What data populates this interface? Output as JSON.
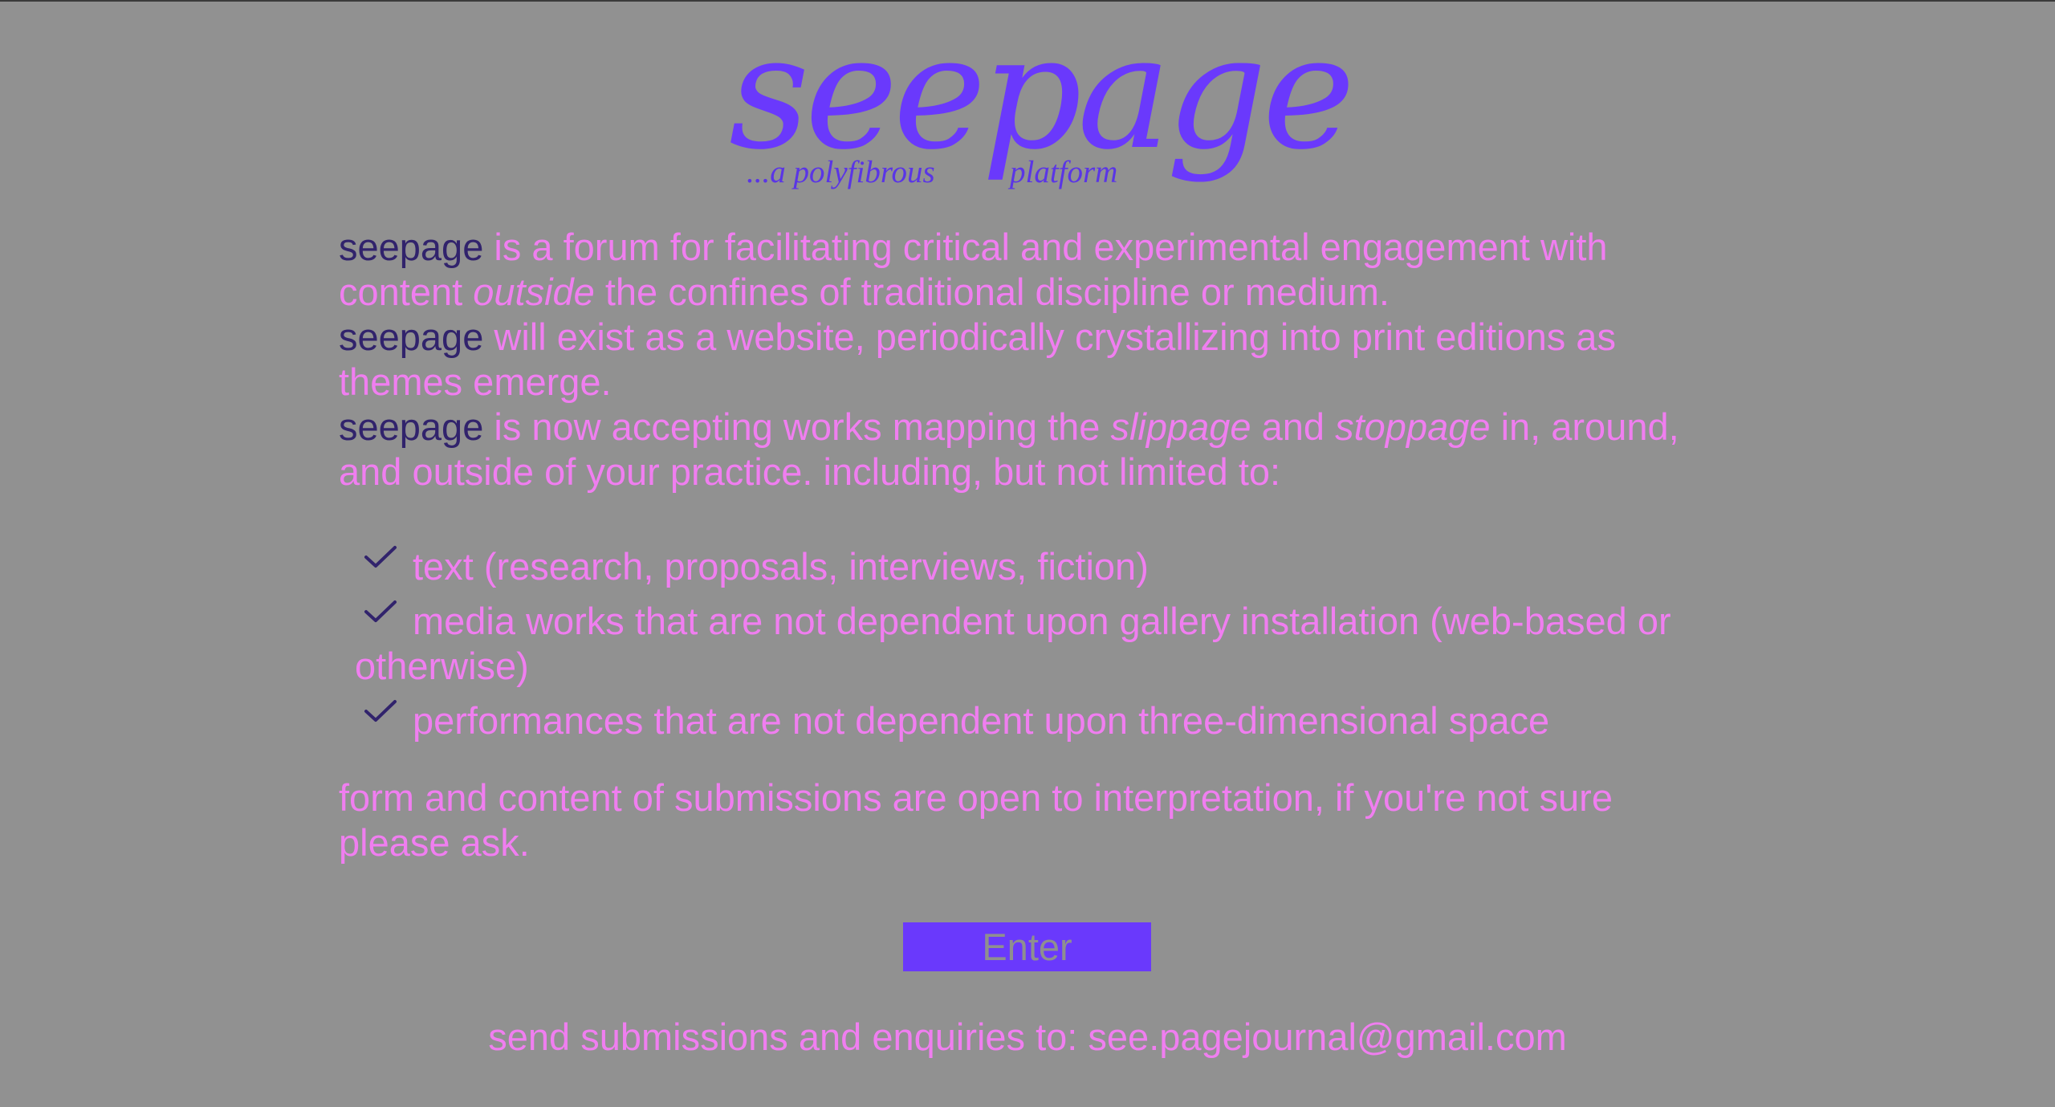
{
  "logo": {
    "word": "seepage",
    "tagline_part1": "...a polyfibrous",
    "tagline_part2": "platform"
  },
  "intro": {
    "brand": "seepage",
    "p1_a": " is a forum for facilitating critical and experimental engagement with content ",
    "p1_em": "outside",
    "p1_b": " the confines of traditional discipline or medium.",
    "p2": " will exist as a website, periodically crystallizing into print editions as themes emerge.",
    "p3_a": " is now accepting works mapping the ",
    "p3_em1": "slippage",
    "p3_b": " and ",
    "p3_em2": "stoppage",
    "p3_c": " in, around, and outside of your practice. including, but not limited to:"
  },
  "features": [
    {
      "label": "text (research, proposals, interviews, fiction)",
      "icon": "checkmark-icon"
    },
    {
      "label": "media works that are not dependent upon gallery installation (web-based or otherwise)",
      "icon": "checkmark-icon"
    },
    {
      "label": "performances that are not dependent upon three-dimensional space",
      "icon": "checkmark-icon"
    }
  ],
  "closing": "form and content of submissions are open to interpretation, if you're not sure please ask.",
  "enter_label": "Enter",
  "footer": "send submissions and enquiries to: see.pagejournal@gmail.com",
  "colors": {
    "background": "#919191",
    "accent_purple": "#6a39fc",
    "text_pink": "#f07ef0",
    "brand_dark": "#31236c"
  }
}
